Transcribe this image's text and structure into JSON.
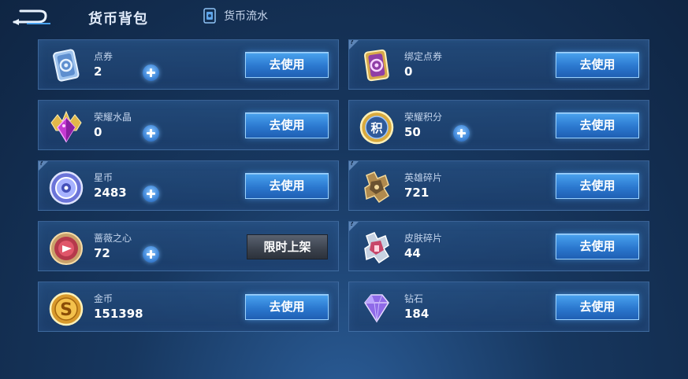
{
  "header": {
    "title": "货币背包",
    "flow_link_label": "货币流水"
  },
  "colors": {
    "accent_blue": "#2b78cf",
    "card_bg": "#1f4674",
    "disabled_button": "#3b424d"
  },
  "left_cards": [
    {
      "id": "dianquan",
      "name": "点券",
      "value": "2",
      "icon": "ticket-icon",
      "has_plus": true,
      "button": "去使用"
    },
    {
      "id": "rongyao-shuijing",
      "name": "荣耀水晶",
      "value": "0",
      "icon": "crystal-icon",
      "has_plus": true,
      "button": "去使用"
    },
    {
      "id": "xingbi",
      "name": "星币",
      "value": "2483",
      "icon": "star-coin-icon",
      "has_plus": true,
      "button": "去使用",
      "info_corner": true
    },
    {
      "id": "qiangwei",
      "name": "蔷薇之心",
      "value": "72",
      "icon": "rose-heart-icon",
      "has_plus": true,
      "button": "限时上架"
    },
    {
      "id": "jinbi",
      "name": "金币",
      "value": "151398",
      "icon": "gold-coin-icon",
      "has_plus": false,
      "button": "去使用"
    }
  ],
  "right_cards": [
    {
      "id": "bangding",
      "name": "绑定点券",
      "value": "0",
      "icon": "bound-ticket-icon",
      "has_plus": false,
      "button": "去使用",
      "info_corner": true
    },
    {
      "id": "jifen",
      "name": "荣耀积分",
      "value": "50",
      "icon": "honor-points-icon",
      "has_plus": true,
      "button": "去使用"
    },
    {
      "id": "yingxiong",
      "name": "英雄碎片",
      "value": "721",
      "icon": "hero-shard-icon",
      "has_plus": false,
      "button": "去使用",
      "info_corner": true
    },
    {
      "id": "pifu",
      "name": "皮肤碎片",
      "value": "44",
      "icon": "skin-shard-icon",
      "has_plus": false,
      "button": "去使用",
      "info_corner": true
    },
    {
      "id": "zuanshi",
      "name": "钻石",
      "value": "184",
      "icon": "diamond-icon",
      "has_plus": false,
      "button": "去使用"
    }
  ]
}
